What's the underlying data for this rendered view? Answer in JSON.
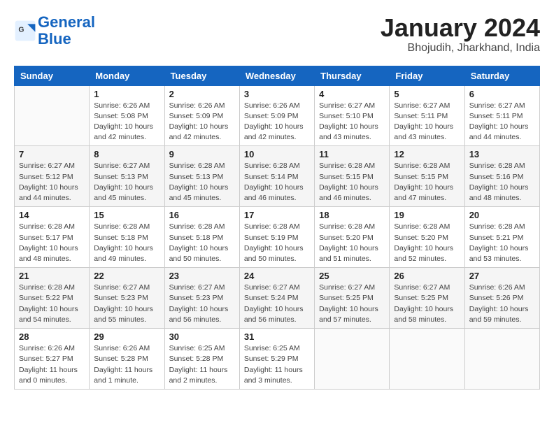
{
  "header": {
    "logo_line1": "General",
    "logo_line2": "Blue",
    "month_year": "January 2024",
    "location": "Bhojudih, Jharkhand, India"
  },
  "days_of_week": [
    "Sunday",
    "Monday",
    "Tuesday",
    "Wednesday",
    "Thursday",
    "Friday",
    "Saturday"
  ],
  "weeks": [
    [
      {
        "day": "",
        "info": ""
      },
      {
        "day": "1",
        "info": "Sunrise: 6:26 AM\nSunset: 5:08 PM\nDaylight: 10 hours\nand 42 minutes."
      },
      {
        "day": "2",
        "info": "Sunrise: 6:26 AM\nSunset: 5:09 PM\nDaylight: 10 hours\nand 42 minutes."
      },
      {
        "day": "3",
        "info": "Sunrise: 6:26 AM\nSunset: 5:09 PM\nDaylight: 10 hours\nand 42 minutes."
      },
      {
        "day": "4",
        "info": "Sunrise: 6:27 AM\nSunset: 5:10 PM\nDaylight: 10 hours\nand 43 minutes."
      },
      {
        "day": "5",
        "info": "Sunrise: 6:27 AM\nSunset: 5:11 PM\nDaylight: 10 hours\nand 43 minutes."
      },
      {
        "day": "6",
        "info": "Sunrise: 6:27 AM\nSunset: 5:11 PM\nDaylight: 10 hours\nand 44 minutes."
      }
    ],
    [
      {
        "day": "7",
        "info": "Sunrise: 6:27 AM\nSunset: 5:12 PM\nDaylight: 10 hours\nand 44 minutes."
      },
      {
        "day": "8",
        "info": "Sunrise: 6:27 AM\nSunset: 5:13 PM\nDaylight: 10 hours\nand 45 minutes."
      },
      {
        "day": "9",
        "info": "Sunrise: 6:28 AM\nSunset: 5:13 PM\nDaylight: 10 hours\nand 45 minutes."
      },
      {
        "day": "10",
        "info": "Sunrise: 6:28 AM\nSunset: 5:14 PM\nDaylight: 10 hours\nand 46 minutes."
      },
      {
        "day": "11",
        "info": "Sunrise: 6:28 AM\nSunset: 5:15 PM\nDaylight: 10 hours\nand 46 minutes."
      },
      {
        "day": "12",
        "info": "Sunrise: 6:28 AM\nSunset: 5:15 PM\nDaylight: 10 hours\nand 47 minutes."
      },
      {
        "day": "13",
        "info": "Sunrise: 6:28 AM\nSunset: 5:16 PM\nDaylight: 10 hours\nand 48 minutes."
      }
    ],
    [
      {
        "day": "14",
        "info": "Sunrise: 6:28 AM\nSunset: 5:17 PM\nDaylight: 10 hours\nand 48 minutes."
      },
      {
        "day": "15",
        "info": "Sunrise: 6:28 AM\nSunset: 5:18 PM\nDaylight: 10 hours\nand 49 minutes."
      },
      {
        "day": "16",
        "info": "Sunrise: 6:28 AM\nSunset: 5:18 PM\nDaylight: 10 hours\nand 50 minutes."
      },
      {
        "day": "17",
        "info": "Sunrise: 6:28 AM\nSunset: 5:19 PM\nDaylight: 10 hours\nand 50 minutes."
      },
      {
        "day": "18",
        "info": "Sunrise: 6:28 AM\nSunset: 5:20 PM\nDaylight: 10 hours\nand 51 minutes."
      },
      {
        "day": "19",
        "info": "Sunrise: 6:28 AM\nSunset: 5:20 PM\nDaylight: 10 hours\nand 52 minutes."
      },
      {
        "day": "20",
        "info": "Sunrise: 6:28 AM\nSunset: 5:21 PM\nDaylight: 10 hours\nand 53 minutes."
      }
    ],
    [
      {
        "day": "21",
        "info": "Sunrise: 6:28 AM\nSunset: 5:22 PM\nDaylight: 10 hours\nand 54 minutes."
      },
      {
        "day": "22",
        "info": "Sunrise: 6:27 AM\nSunset: 5:23 PM\nDaylight: 10 hours\nand 55 minutes."
      },
      {
        "day": "23",
        "info": "Sunrise: 6:27 AM\nSunset: 5:23 PM\nDaylight: 10 hours\nand 56 minutes."
      },
      {
        "day": "24",
        "info": "Sunrise: 6:27 AM\nSunset: 5:24 PM\nDaylight: 10 hours\nand 56 minutes."
      },
      {
        "day": "25",
        "info": "Sunrise: 6:27 AM\nSunset: 5:25 PM\nDaylight: 10 hours\nand 57 minutes."
      },
      {
        "day": "26",
        "info": "Sunrise: 6:27 AM\nSunset: 5:25 PM\nDaylight: 10 hours\nand 58 minutes."
      },
      {
        "day": "27",
        "info": "Sunrise: 6:26 AM\nSunset: 5:26 PM\nDaylight: 10 hours\nand 59 minutes."
      }
    ],
    [
      {
        "day": "28",
        "info": "Sunrise: 6:26 AM\nSunset: 5:27 PM\nDaylight: 11 hours\nand 0 minutes."
      },
      {
        "day": "29",
        "info": "Sunrise: 6:26 AM\nSunset: 5:28 PM\nDaylight: 11 hours\nand 1 minute."
      },
      {
        "day": "30",
        "info": "Sunrise: 6:25 AM\nSunset: 5:28 PM\nDaylight: 11 hours\nand 2 minutes."
      },
      {
        "day": "31",
        "info": "Sunrise: 6:25 AM\nSunset: 5:29 PM\nDaylight: 11 hours\nand 3 minutes."
      },
      {
        "day": "",
        "info": ""
      },
      {
        "day": "",
        "info": ""
      },
      {
        "day": "",
        "info": ""
      }
    ]
  ]
}
